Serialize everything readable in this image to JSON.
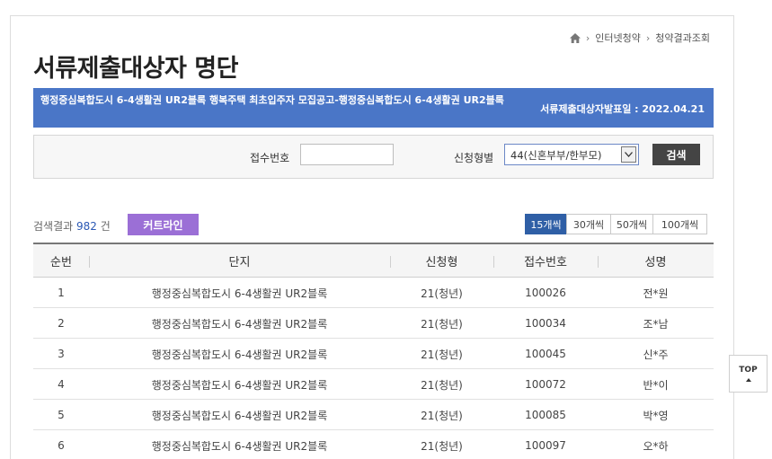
{
  "breadcrumb": {
    "items": [
      "인터넷청약",
      "청약결과조회"
    ]
  },
  "page_title": "서류제출대상자 명단",
  "banner": {
    "notice_title": "행정중심복합도시 6-4생활권 UR2블록 행복주택 최초입주자 모집공고-행정중심복합도시 6-4생활권 UR2블록",
    "announce_date": "서류제출대상자발표일 : 2022.04.21"
  },
  "search": {
    "receipt_label": "접수번호",
    "receipt_value": "",
    "type_label": "신청형별",
    "type_selected": "44(신혼부부/한부모)",
    "search_button": "검색"
  },
  "results": {
    "prefix": "검색결과",
    "count": "982",
    "suffix": "건",
    "curtain_button": "커트라인"
  },
  "page_sizes": [
    "15개씩",
    "30개씩",
    "50개씩",
    "100개씩"
  ],
  "page_size_active": "15개씩",
  "table": {
    "headers": [
      "순번",
      "단지",
      "신청형",
      "접수번호",
      "성명"
    ],
    "rows": [
      [
        "1",
        "행정중심복합도시 6-4생활권 UR2블록",
        "21(청년)",
        "100026",
        "전*원"
      ],
      [
        "2",
        "행정중심복합도시 6-4생활권 UR2블록",
        "21(청년)",
        "100034",
        "조*남"
      ],
      [
        "3",
        "행정중심복합도시 6-4생활권 UR2블록",
        "21(청년)",
        "100045",
        "신*주"
      ],
      [
        "4",
        "행정중심복합도시 6-4생활권 UR2블록",
        "21(청년)",
        "100072",
        "반*이"
      ],
      [
        "5",
        "행정중심복합도시 6-4생활권 UR2블록",
        "21(청년)",
        "100085",
        "박*영"
      ],
      [
        "6",
        "행정중심복합도시 6-4생활권 UR2블록",
        "21(청년)",
        "100097",
        "오*하"
      ]
    ]
  },
  "top_button": "TOP",
  "colors": {
    "banner": "#4a76c7",
    "curtain": "#9b6fd6",
    "active_page_size": "#2f5fa6",
    "count": "#2a58b4"
  },
  "icons": {
    "home": "home-icon",
    "breadcrumb_separator": "chevron-right-icon",
    "select_arrow": "chevron-down-icon",
    "top_arrow": "arrow-up-icon"
  }
}
